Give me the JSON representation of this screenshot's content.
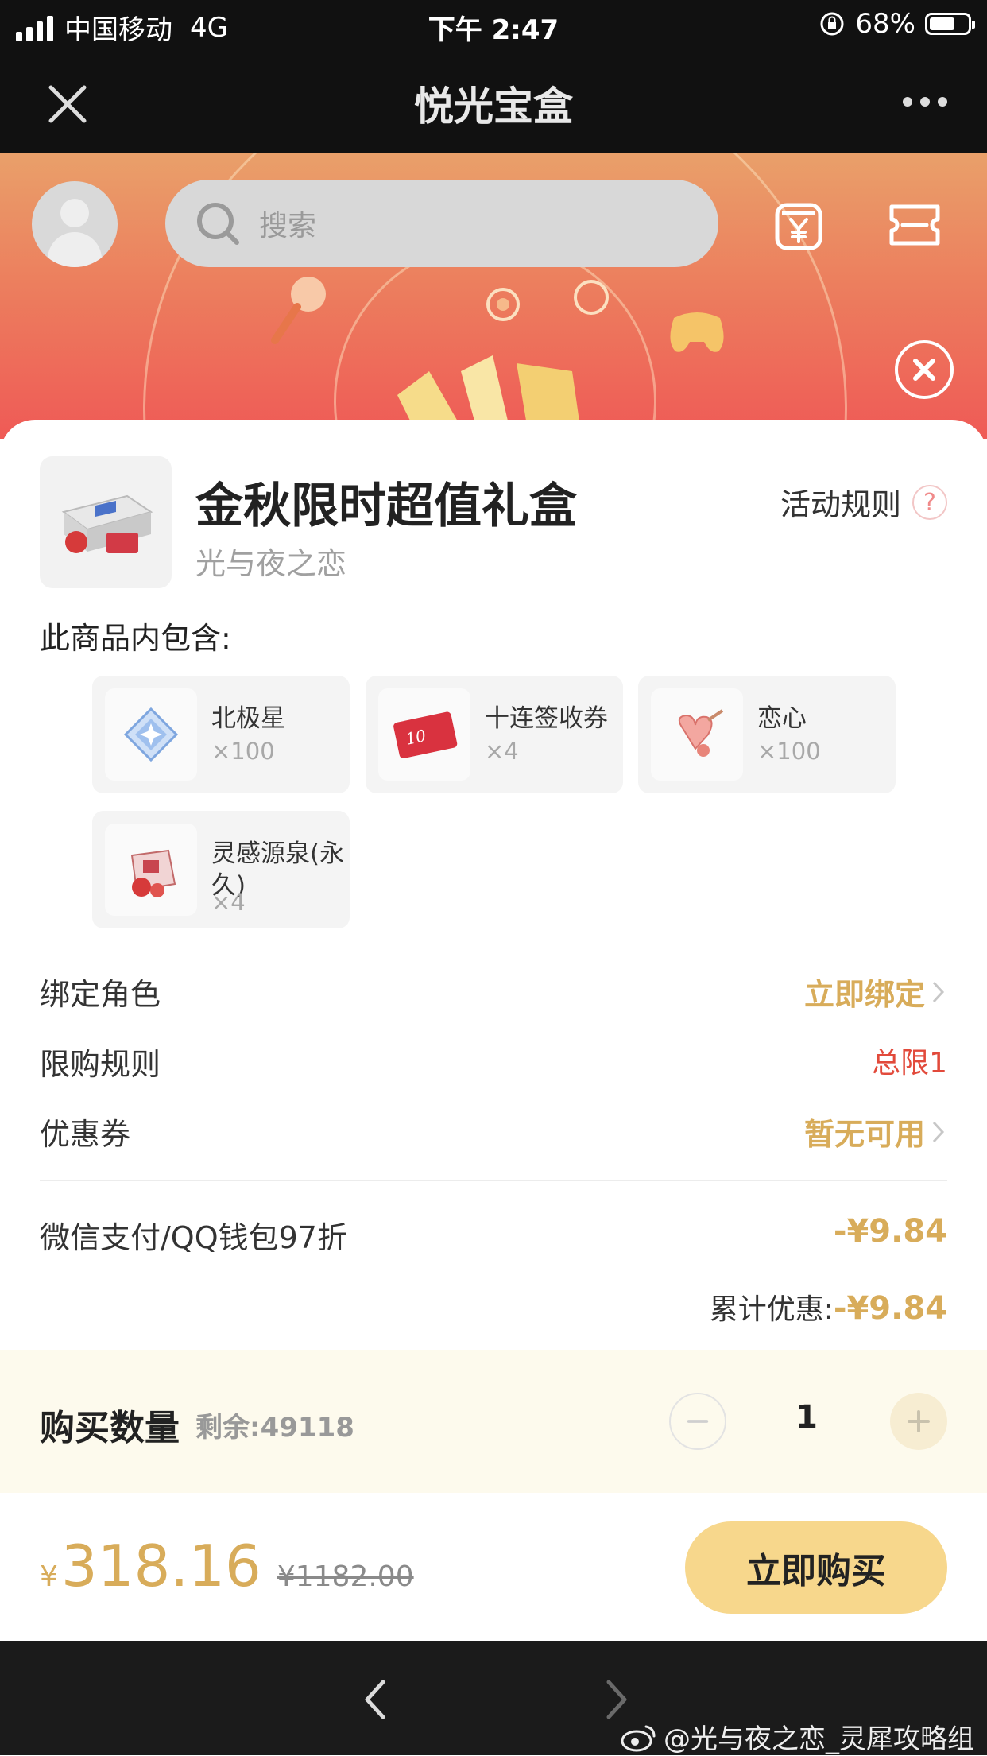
{
  "status_bar": {
    "carrier": "中国移动",
    "network": "4G",
    "time": "下午 2:47",
    "battery_percent": "68%",
    "battery_level": 0.68
  },
  "nav": {
    "title": "悦光宝盒",
    "close_icon": "close-icon",
    "more_icon": "more-icon"
  },
  "banner": {
    "search_placeholder": "搜索",
    "wallet_icon": "wallet-yen-icon",
    "ticket_icon": "ticket-icon"
  },
  "product": {
    "title": "金秋限时超值礼盒",
    "game": "光与夜之恋",
    "rules_label": "活动规则",
    "rules_icon": "?"
  },
  "contents": {
    "label": "此商品内包含:",
    "items": [
      {
        "name": "北极星",
        "count": "×100",
        "icon": "diamond-star-icon"
      },
      {
        "name": "十连签收券",
        "count": "×4",
        "icon": "ticket-card-icon"
      },
      {
        "name": "恋心",
        "count": "×100",
        "icon": "love-heart-icon"
      },
      {
        "name": "灵感源泉(永久)",
        "count": "×4",
        "icon": "gift-box-icon"
      }
    ]
  },
  "details": {
    "bind_role_label": "绑定角色",
    "bind_role_value": "立即绑定",
    "limit_label": "限购规则",
    "limit_value": "总限1",
    "coupon_label": "优惠券",
    "coupon_value": "暂无可用"
  },
  "discount": {
    "label": "微信支付/QQ钱包97折",
    "value": "-¥9.84",
    "total_label": "累计优惠:",
    "total_value": "-¥9.84"
  },
  "quantity": {
    "label": "购买数量",
    "remaining": "剩余:49118",
    "value": "1"
  },
  "purchase": {
    "currency": "¥",
    "price": "318.16",
    "original_price": "¥1182.00",
    "buy_label": "立即购买"
  },
  "footer": {
    "watermark": "@光与夜之恋_灵犀攻略组"
  },
  "colors": {
    "gold": "#d8ac5a",
    "limit_red": "#e24a3b",
    "buy_button": "#f7d78c",
    "banner_top": "#e9a06a",
    "banner_bottom": "#ef5a56"
  }
}
